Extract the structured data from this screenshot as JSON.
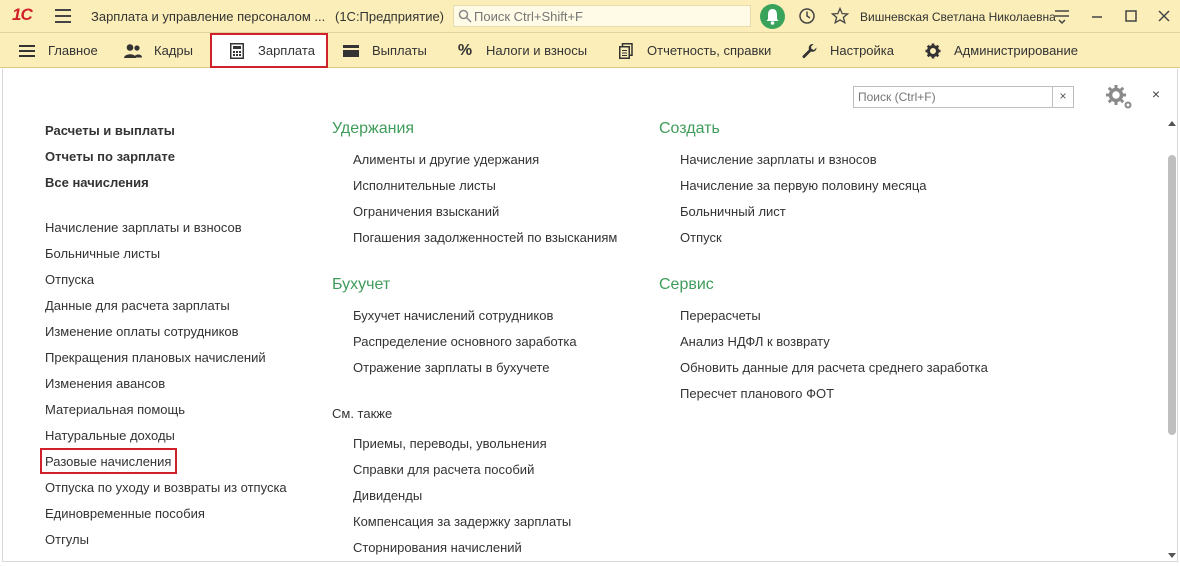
{
  "titlebar": {
    "logo": "1С",
    "app_title": "Зарплата и управление персоналом ...",
    "platform": "(1С:Предприятие)",
    "search_placeholder": "Поиск Ctrl+Shift+F",
    "user": "Вишневская Светлана Николаевна"
  },
  "sections": [
    {
      "label": "Главное",
      "icon": "hamburger-icon"
    },
    {
      "label": "Кадры",
      "icon": "people-icon"
    },
    {
      "label": "Зарплата",
      "icon": "calculator-icon",
      "active": true
    },
    {
      "label": "Выплаты",
      "icon": "wallet-icon"
    },
    {
      "label": "Налоги и взносы",
      "icon": "percent-icon"
    },
    {
      "label": "Отчетность, справки",
      "icon": "documents-icon"
    },
    {
      "label": "Настройка",
      "icon": "wrench-icon"
    },
    {
      "label": "Администрирование",
      "icon": "gear-icon"
    }
  ],
  "local_search": {
    "placeholder": "Поиск (Ctrl+F)",
    "clear": "×"
  },
  "close": "×",
  "col1": {
    "bold": [
      "Расчеты и выплаты",
      "Отчеты по зарплате",
      "Все начисления"
    ],
    "items": [
      "Начисление зарплаты и взносов",
      "Больничные листы",
      "Отпуска",
      "Данные для расчета зарплаты",
      "Изменение оплаты сотрудников",
      "Прекращения плановых начислений",
      "Изменения авансов",
      "Материальная помощь",
      "Натуральные доходы",
      "Разовые начисления",
      "Отпуска по уходу и возвраты из отпуска",
      "Единовременные пособия",
      "Отгулы"
    ]
  },
  "col2": {
    "groups": [
      {
        "title": "Удержания",
        "items": [
          "Алименты и другие удержания",
          "Исполнительные листы",
          "Ограничения взысканий",
          "Погашения задолженностей по взысканиям"
        ]
      },
      {
        "title": "Бухучет",
        "items": [
          "Бухучет начислений сотрудников",
          "Распределение основного заработка",
          "Отражение зарплаты в бухучете"
        ]
      },
      {
        "title": "См. также",
        "items": [
          "Приемы, переводы, увольнения",
          "Справки для расчета пособий",
          "Дивиденды",
          "Компенсация за задержку зарплаты",
          "Сторнирования начислений"
        ]
      }
    ]
  },
  "col3": {
    "groups": [
      {
        "title": "Создать",
        "items": [
          "Начисление зарплаты и взносов",
          "Начисление за первую половину месяца",
          "Больничный лист",
          "Отпуск"
        ]
      },
      {
        "title": "Сервис",
        "items": [
          "Перерасчеты",
          "Анализ НДФЛ к возврату",
          "Обновить данные для расчета среднего заработка",
          "Пересчет планового ФОТ"
        ]
      }
    ]
  },
  "colors": {
    "accent_green": "#3f9c5a",
    "highlight_red": "#d0202a",
    "bar_yellow": "#fbeeb9"
  }
}
